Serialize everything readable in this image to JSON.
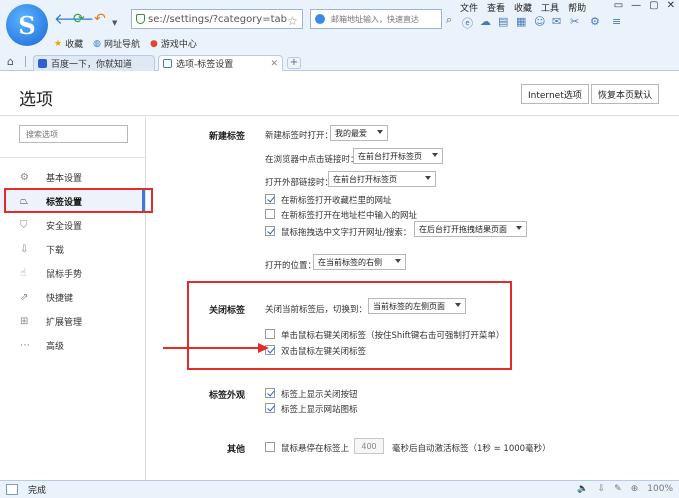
{
  "browser": {
    "url": "se://settings/?category=tab",
    "search_placeholder": "邮箱地址输入，快速直达",
    "top_menu": [
      "文件",
      "查看",
      "收藏",
      "工具",
      "帮助"
    ],
    "favorites": [
      {
        "label": "收藏",
        "icon": "star-icon"
      },
      {
        "label": "网址导航",
        "icon": "globe-icon"
      },
      {
        "label": "游戏中心",
        "icon": "game-icon"
      }
    ],
    "tabs": [
      {
        "label": "百度一下，你就知道",
        "active": false
      },
      {
        "label": "选项-标签设置",
        "active": true
      }
    ],
    "new_tab": "+"
  },
  "page": {
    "title": "选项",
    "btn_internet": "Internet选项",
    "btn_restore": "恢复本页默认",
    "search_placeholder": "搜索选项"
  },
  "sidebar": {
    "items": [
      {
        "label": "基本设置",
        "icon": "gear-icon",
        "active": false
      },
      {
        "label": "标签设置",
        "icon": "tab-icon",
        "active": true
      },
      {
        "label": "安全设置",
        "icon": "shield-icon",
        "active": false
      },
      {
        "label": "下载",
        "icon": "download-icon",
        "active": false
      },
      {
        "label": "鼠标手势",
        "icon": "hand-icon",
        "active": false
      },
      {
        "label": "快捷键",
        "icon": "shortcut-icon",
        "active": false
      },
      {
        "label": "扩展管理",
        "icon": "extension-icon",
        "active": false
      },
      {
        "label": "高级",
        "icon": "more-icon",
        "active": false
      }
    ]
  },
  "new_tab_section": {
    "title": "新建标签",
    "open_new_tab_label": "新建标签时打开：",
    "open_new_tab_value": "我的最爱",
    "click_link_label": "在浏览器中点击链接时：",
    "click_link_value": "在前台打开标签页",
    "external_link_label": "打开外部链接时：",
    "external_link_value": "在前台打开标签页",
    "cb_fav_bar": {
      "label": "在新标签打开收藏栏里的网址",
      "checked": true
    },
    "cb_address_bar": {
      "label": "在新标签打开在地址栏中输入的网址",
      "checked": false
    },
    "cb_drag": {
      "label": "鼠标拖拽选中文字打开网址/搜索：",
      "checked": true
    },
    "drag_value": "在后台打开拖拽结果页面",
    "position_label": "打开的位置：",
    "position_value": "在当前标签的右侧"
  },
  "close_tab_section": {
    "title": "关闭标签",
    "switch_label": "关闭当前标签后，切换到：",
    "switch_value": "当前标签的左侧页面",
    "cb_right_click": {
      "label": "单击鼠标右键关闭标签（按住Shift键右击可强制打开菜单）",
      "checked": false
    },
    "cb_double_click": {
      "label": "双击鼠标左键关闭标签",
      "checked": true
    }
  },
  "tab_appearance_section": {
    "title": "标签外观",
    "cb_close_button": {
      "label": "标签上显示关闭按钮",
      "checked": true
    },
    "cb_site_icon": {
      "label": "标签上显示网站图标",
      "checked": true
    }
  },
  "other_section": {
    "title": "其他",
    "cb_hover": {
      "label": "鼠标悬停在标签上",
      "checked": false
    },
    "hover_ms": "400",
    "hover_suffix": "毫秒后自动激活标签（1秒 = 1000毫秒）"
  },
  "status": {
    "text": "完成",
    "zoom": "100%"
  },
  "colors": {
    "annotation_red": "#e32b2b",
    "active_accent": "#3d7ad6",
    "check_blue": "#2a62c0"
  }
}
